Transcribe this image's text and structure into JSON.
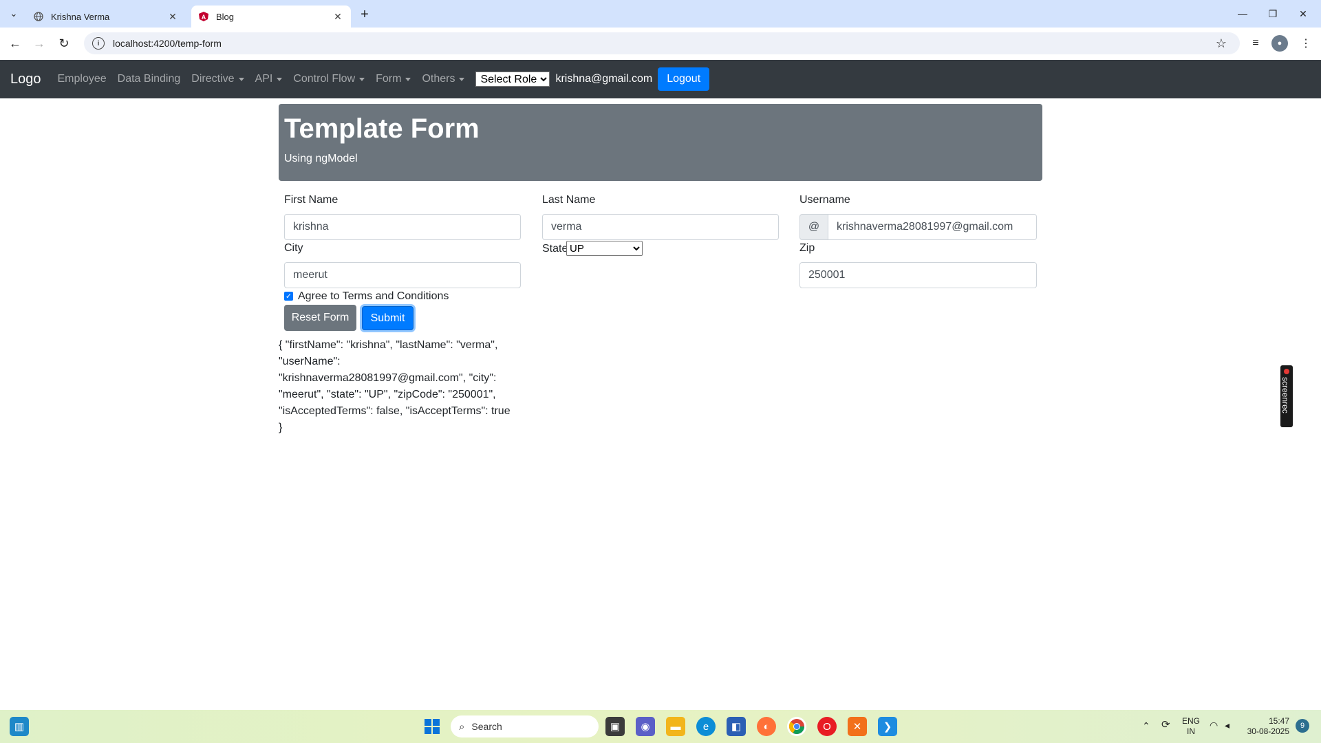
{
  "browser": {
    "tabs": [
      {
        "title": "Krishna Verma",
        "icon": "globe-icon",
        "active": false
      },
      {
        "title": "Blog",
        "icon": "angular-icon",
        "active": true
      }
    ],
    "url": "localhost:4200/temp-form"
  },
  "navbar": {
    "brand": "Logo",
    "links": [
      {
        "label": "Employee",
        "dropdown": false
      },
      {
        "label": "Data Binding",
        "dropdown": false
      },
      {
        "label": "Directive",
        "dropdown": true
      },
      {
        "label": "API",
        "dropdown": true
      },
      {
        "label": "Control Flow",
        "dropdown": true
      },
      {
        "label": "Form",
        "dropdown": true
      },
      {
        "label": "Others",
        "dropdown": true
      }
    ],
    "role_select": "Select Role",
    "user_email": "krishna@gmail.com",
    "logout": "Logout"
  },
  "header": {
    "title": "Template Form",
    "subtitle": "Using ngModel"
  },
  "form": {
    "first_name": {
      "label": "First Name",
      "value": "krishna"
    },
    "last_name": {
      "label": "Last Name",
      "value": "verma"
    },
    "username": {
      "label": "Username",
      "prepend": "@",
      "value": "krishnaverma28081997@gmail.com"
    },
    "city": {
      "label": "City",
      "value": "meerut"
    },
    "state": {
      "label": "State",
      "value": "UP"
    },
    "zip": {
      "label": "Zip",
      "value": "250001"
    },
    "terms": {
      "label": "Agree to Terms and Conditions",
      "checked": true
    },
    "reset": "Reset Form",
    "submit": "Submit"
  },
  "json_output": "{ \"firstName\": \"krishna\", \"lastName\": \"verma\", \"userName\": \"krishnaverma28081997@gmail.com\", \"city\": \"meerut\", \"state\": \"UP\", \"zipCode\": \"250001\", \"isAcceptedTerms\": false, \"isAcceptTerms\": true }",
  "overlay": {
    "screenrec": "screenrec"
  },
  "taskbar": {
    "search_placeholder": "Search",
    "lang_top": "ENG",
    "lang_bottom": "IN",
    "time": "15:47",
    "date": "30-08-2025",
    "notifications": "9"
  }
}
